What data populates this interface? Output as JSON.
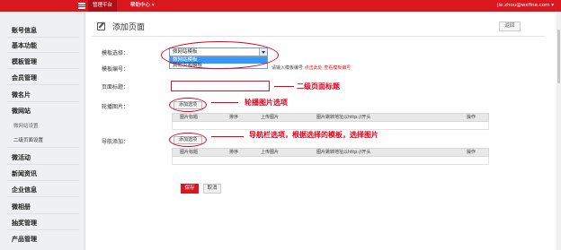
{
  "topbar": {
    "tab_active": "管理平台",
    "tab_menu": "帮助中心 ▾",
    "user": "jie.zhou@wxfine.com ▾"
  },
  "sidebar": {
    "items": [
      {
        "label": "账号信息"
      },
      {
        "label": "基本功能"
      },
      {
        "label": "模板管理"
      },
      {
        "label": "会员管理"
      },
      {
        "label": "微名片"
      },
      {
        "label": "微网站"
      },
      {
        "label": "微网站设置"
      },
      {
        "label": "二级页面设置"
      },
      {
        "label": "微活动"
      },
      {
        "label": "新闻资讯"
      },
      {
        "label": "企业信息"
      },
      {
        "label": "微相册"
      },
      {
        "label": "抽奖管理"
      },
      {
        "label": "产品管理"
      }
    ]
  },
  "header": {
    "title": "添加页面",
    "back_label": "返回"
  },
  "form": {
    "template_label": "模板选择：",
    "template_selected": "微网站模板",
    "template_options": [
      "微网站模板",
      "其他页面模板"
    ],
    "code_label": "模板编号：",
    "code_hint": "请输入模板编号",
    "code_link": "点击此处 查看模板编号",
    "title_label": "页面标题：",
    "title_value": "",
    "carousel_label": "轮播图片：",
    "carousel_add": "添加选项",
    "nav_label": "导航添加：",
    "nav_add": "添加选项",
    "carousel_columns": [
      "图片标题",
      "排序",
      "上传图片",
      "图片跳转地址以http://开头",
      "操作"
    ],
    "nav_columns": [
      "图片标题",
      "排序",
      "上传图片",
      "图片跳转地址以http://开头",
      "操作"
    ],
    "save_label": "保存",
    "cancel_label": "取消"
  },
  "annotations": {
    "title_note": "二级页面标题",
    "carousel_note": "轮播图片选项",
    "nav_note": "导航栏选项，根据选择的模板，选择图片"
  },
  "colors": {
    "brand": "#d9171e",
    "annotation": "#e0001b",
    "selection": "#3399ff"
  }
}
